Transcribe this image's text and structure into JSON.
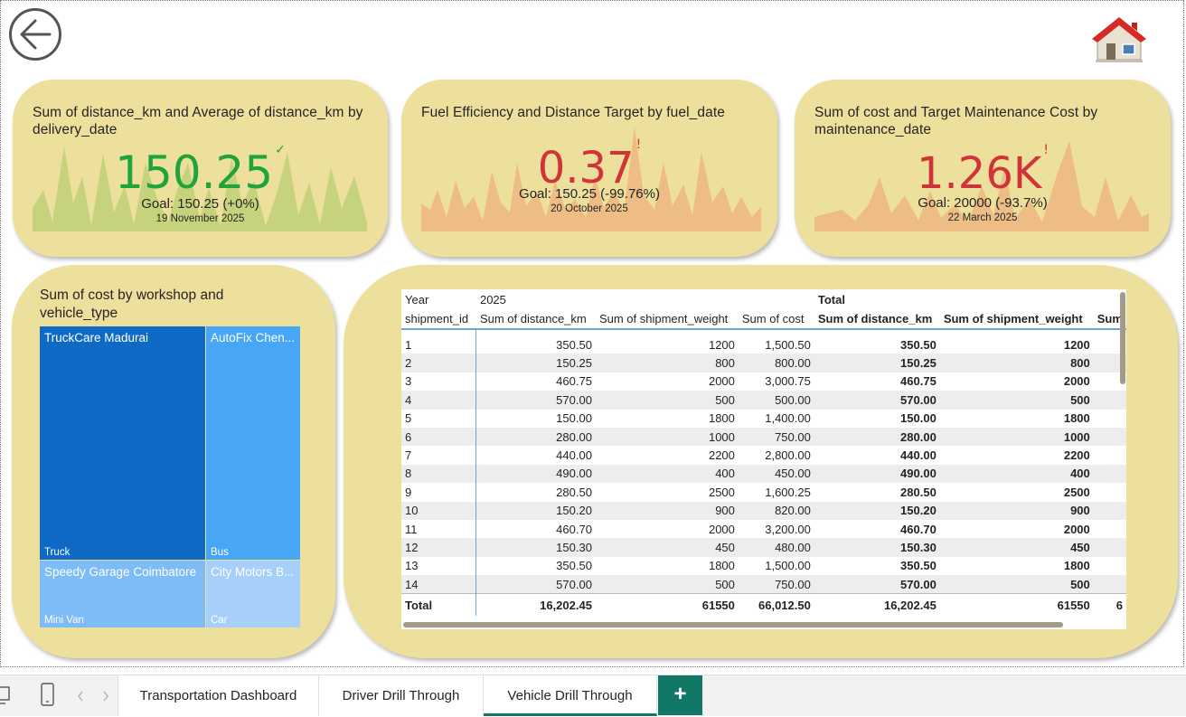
{
  "colors": {
    "card_bg": "#eddf9c",
    "good": "#1fa33a",
    "bad": "#d13438",
    "spark_green": "#b9cf72",
    "spark_orange": "#eeb07e",
    "treemap_dark": "#0f6ac5",
    "treemap_mid": "#48a6f7",
    "treemap_light": "#7dbcf7",
    "treemap_lightest": "#a6cff9",
    "tab_accent": "#117865"
  },
  "nav": {
    "back_icon": "arrow-left-circle-icon",
    "home_icon": "house-icon"
  },
  "kpis": [
    {
      "title": "Sum of distance_km and Average of distance_km by delivery_date",
      "value": "150.25",
      "status_mark": "✓",
      "status": "good",
      "goal": "Goal: 150.25 (+0%)",
      "date": "19 November 2025"
    },
    {
      "title": "Fuel Efficiency and Distance Target by fuel_date",
      "value": "0.37",
      "status_mark": "!",
      "status": "bad",
      "goal": "Goal: 150.25 (-99.76%)",
      "date": "20 October 2025"
    },
    {
      "title": "Sum of cost and Target Maintenance Cost by maintenance_date",
      "value": "1.26K",
      "status_mark": "!",
      "status": "bad",
      "goal": "Goal: 20000 (-93.7%)",
      "date": "22 March 2025"
    }
  ],
  "treemap": {
    "title": "Sum of cost by workshop and vehicle_type",
    "cells": [
      {
        "workshop": "TruckCare Madurai",
        "vehicle_type": "Truck"
      },
      {
        "workshop": "AutoFix Chen...",
        "vehicle_type": "Bus"
      },
      {
        "workshop": "Speedy Garage Coimbatore",
        "vehicle_type": "Mini Van"
      },
      {
        "workshop": "City Motors B...",
        "vehicle_type": "Car"
      }
    ]
  },
  "matrix": {
    "year_label": "Year",
    "year_value": "2025",
    "total_label": "Total",
    "row_header": "shipment_id",
    "columns": [
      "Sum of distance_km",
      "Sum of shipment_weight",
      "Sum of cost"
    ],
    "total_columns": [
      "Sum of distance_km",
      "Sum of shipment_weight",
      "Sum"
    ],
    "rows": [
      [
        "1",
        "350.50",
        "1200",
        "1,500.50",
        "350.50",
        "1200"
      ],
      [
        "2",
        "150.25",
        "800",
        "800.00",
        "150.25",
        "800"
      ],
      [
        "3",
        "460.75",
        "2000",
        "3,000.75",
        "460.75",
        "2000"
      ],
      [
        "4",
        "570.00",
        "500",
        "500.00",
        "570.00",
        "500"
      ],
      [
        "5",
        "150.00",
        "1800",
        "1,400.00",
        "150.00",
        "1800"
      ],
      [
        "6",
        "280.00",
        "1000",
        "750.00",
        "280.00",
        "1000"
      ],
      [
        "7",
        "440.00",
        "2200",
        "2,800.00",
        "440.00",
        "2200"
      ],
      [
        "8",
        "490.00",
        "400",
        "450.00",
        "490.00",
        "400"
      ],
      [
        "9",
        "280.50",
        "2500",
        "1,600.25",
        "280.50",
        "2500"
      ],
      [
        "10",
        "150.20",
        "900",
        "820.00",
        "150.20",
        "900"
      ],
      [
        "11",
        "460.70",
        "2000",
        "3,200.00",
        "460.70",
        "2000"
      ],
      [
        "12",
        "150.30",
        "450",
        "480.00",
        "150.30",
        "450"
      ],
      [
        "13",
        "350.50",
        "1800",
        "1,500.00",
        "350.50",
        "1800"
      ],
      [
        "14",
        "570.00",
        "500",
        "750.00",
        "570.00",
        "500"
      ]
    ],
    "total_row": [
      "Total",
      "16,202.45",
      "61550",
      "66,012.50",
      "16,202.45",
      "61550",
      "6"
    ]
  },
  "tabs": {
    "desktop_icon": "desktop-layout-icon",
    "phone_icon": "phone-layout-icon",
    "prev_icon": "chevron-left-icon",
    "next_icon": "chevron-right-icon",
    "pages": [
      "Transportation Dashboard",
      "Driver Drill Through",
      "Vehicle Drill Through"
    ],
    "active": "Vehicle Drill Through",
    "add_label": "+"
  }
}
